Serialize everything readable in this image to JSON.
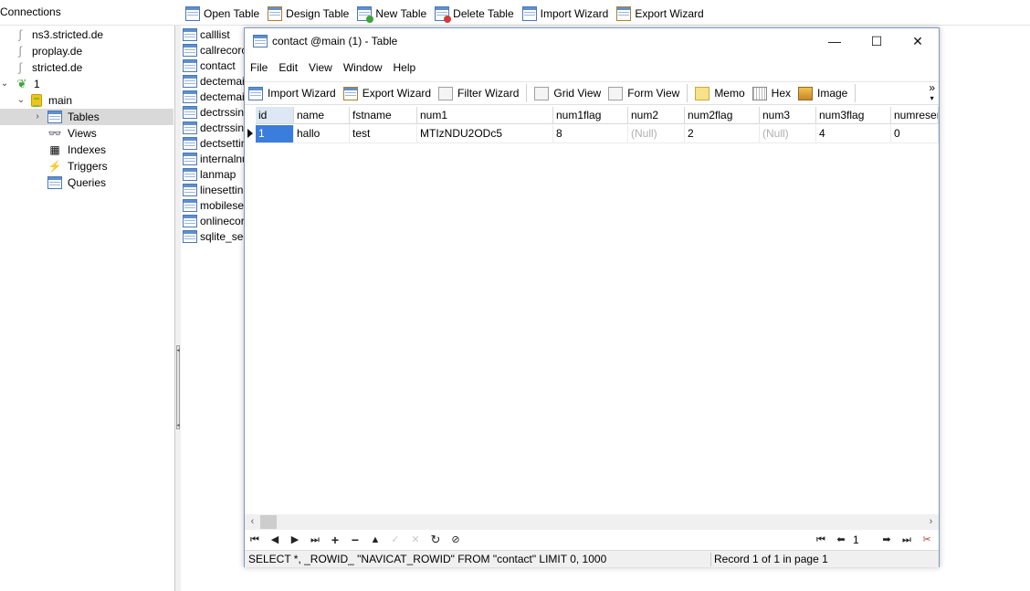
{
  "connections_panel": {
    "title": "Connections",
    "items": [
      {
        "label": "ns3.stricted.de"
      },
      {
        "label": "proplay.de"
      },
      {
        "label": "stricted.de"
      },
      {
        "label": "1"
      },
      {
        "label": "main"
      },
      {
        "label": "Tables"
      },
      {
        "label": "Views"
      },
      {
        "label": "Indexes"
      },
      {
        "label": "Triggers"
      },
      {
        "label": "Queries"
      }
    ]
  },
  "main_toolbar": {
    "open_table": "Open Table",
    "design_table": "Design Table",
    "new_table": "New Table",
    "delete_table": "Delete Table",
    "import_wizard": "Import Wizard",
    "export_wizard": "Export Wizard"
  },
  "table_list": [
    "calllist",
    "callrecorc",
    "contact",
    "dectemai",
    "dectemai",
    "dectrssin",
    "dectrssin",
    "dectsettin",
    "internalnu",
    "lanmap",
    "linesettin",
    "mobilese",
    "onlinecor",
    "sqlite_sec"
  ],
  "window": {
    "title": "contact @main (1) - Table",
    "controls": {
      "minimize": "—",
      "maximize": "☐",
      "close": "✕"
    },
    "menu": [
      "File",
      "Edit",
      "View",
      "Window",
      "Help"
    ],
    "toolbar": {
      "import_wizard": "Import Wizard",
      "export_wizard": "Export Wizard",
      "filter_wizard": "Filter Wizard",
      "grid_view": "Grid View",
      "form_view": "Form View",
      "memo": "Memo",
      "hex": "Hex",
      "image": "Image",
      "overflow": "»"
    },
    "grid": {
      "columns": [
        "id",
        "name",
        "fstname",
        "num1",
        "num1flag",
        "num2",
        "num2flag",
        "num3",
        "num3flag",
        "numreser"
      ],
      "rows": [
        [
          "1",
          "hallo",
          "test",
          "MTIzNDU2ODc5",
          "8",
          "(Null)",
          "2",
          "(Null)",
          "4",
          "0"
        ]
      ]
    },
    "nav": {
      "page": "1"
    },
    "status": {
      "sql": "SELECT *, _ROWID_ \"NAVICAT_ROWID\" FROM \"contact\" LIMIT 0, 1000",
      "record": "Record 1 of 1 in page 1"
    }
  }
}
